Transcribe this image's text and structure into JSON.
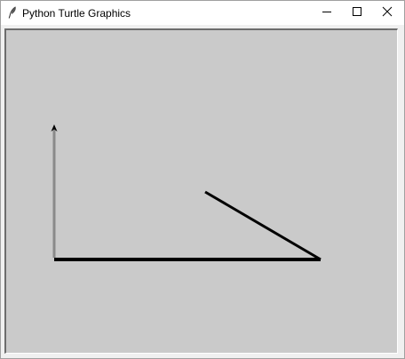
{
  "window": {
    "title": "Python Turtle Graphics",
    "icon": "feather-icon",
    "controls": {
      "minimize": "minimize-icon",
      "maximize": "maximize-icon",
      "close": "close-icon"
    }
  },
  "canvas": {
    "background": "#cacaca",
    "pen_color": "#000000"
  }
}
